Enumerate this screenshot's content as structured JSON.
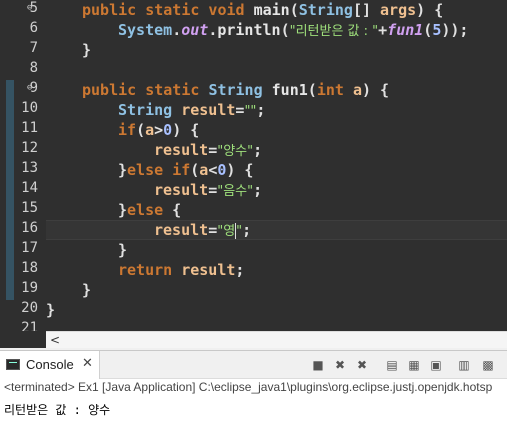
{
  "editor": {
    "lines": [
      {
        "num": "5",
        "fold": "⊖"
      },
      {
        "num": "6",
        "fold": ""
      },
      {
        "num": "7",
        "fold": ""
      },
      {
        "num": "8",
        "fold": ""
      },
      {
        "num": "9",
        "fold": "⊖"
      },
      {
        "num": "10",
        "fold": ""
      },
      {
        "num": "11",
        "fold": ""
      },
      {
        "num": "12",
        "fold": ""
      },
      {
        "num": "13",
        "fold": ""
      },
      {
        "num": "14",
        "fold": ""
      },
      {
        "num": "15",
        "fold": ""
      },
      {
        "num": "16",
        "fold": ""
      },
      {
        "num": "17",
        "fold": ""
      },
      {
        "num": "18",
        "fold": ""
      },
      {
        "num": "19",
        "fold": ""
      },
      {
        "num": "20",
        "fold": ""
      },
      {
        "num": "21",
        "fold": ""
      }
    ],
    "code": {
      "l5": {
        "kw1": "public static void ",
        "fn": "main",
        "p1": "(",
        "ty": "String",
        "p2": "[] ",
        "id": "args",
        "p3": ") {"
      },
      "l6": {
        "ty": "System",
        "p1": ".",
        "it": "out",
        "p2": ".",
        "fn": "println",
        "p3": "(",
        "st": "\"리턴받은 값 : \"",
        "p4": "+",
        "it2": "fun1",
        "p5": "(",
        "nm": "5",
        "p6": "));"
      },
      "l7": {
        "p1": "}"
      },
      "l9": {
        "kw1": "public static ",
        "ty": "String ",
        "fn": "fun1",
        "p1": "(",
        "kw2": "int ",
        "id": "a",
        "p2": ") {"
      },
      "l10": {
        "ty": "String ",
        "id": "result",
        "p1": "=",
        "st": "\"\"",
        "p2": ";"
      },
      "l11": {
        "kw": "if",
        "p1": "(",
        "id": "a",
        "p2": ">",
        "nm": "0",
        "p3": ") {"
      },
      "l12": {
        "id": "result",
        "p1": "=",
        "st": "\"양수\"",
        "p2": ";"
      },
      "l13": {
        "p1": "}",
        "kw1": "else ",
        "kw2": "if",
        "p2": "(",
        "id": "a",
        "p3": "<",
        "nm": "0",
        "p4": ") {"
      },
      "l14": {
        "id": "result",
        "p1": "=",
        "st": "\"음수\"",
        "p2": ";"
      },
      "l15": {
        "p1": "}",
        "kw": "else",
        "p2": " {"
      },
      "l16": {
        "id": "result",
        "p1": "=",
        "st1": "\"영",
        "st2": "\"",
        "p2": ";"
      },
      "l17": {
        "p1": "}"
      },
      "l18": {
        "kw": "return ",
        "id": "result",
        "p1": ";"
      },
      "l19": {
        "p1": "}"
      },
      "l20": {
        "p1": "}"
      }
    },
    "scroll_arrow": "<"
  },
  "console": {
    "tab_label": "Console",
    "close_glyph": "✕",
    "toolbar": [
      {
        "name": "terminate-icon",
        "glyph": "■"
      },
      {
        "name": "remove-launch-icon",
        "glyph": "✖"
      },
      {
        "name": "remove-all-icon",
        "glyph": "✖"
      },
      {
        "name": "scroll-lock-icon",
        "glyph": "▤"
      },
      {
        "name": "word-wrap-icon",
        "glyph": "▦"
      },
      {
        "name": "pin-console-icon",
        "glyph": "▣"
      },
      {
        "name": "display-selected-icon",
        "glyph": "▥"
      },
      {
        "name": "open-console-icon",
        "glyph": "▩"
      }
    ],
    "status": "<terminated> Ex1 [Java Application] C:\\eclipse_java1\\plugins\\org.eclipse.justj.openjdk.hotsp",
    "output": "리턴받은 값 : 양수"
  }
}
